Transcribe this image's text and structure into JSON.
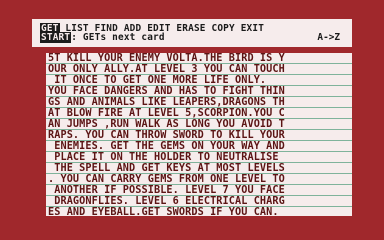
{
  "menu": {
    "get": "GET",
    "rest": " LIST FIND ADD EDIT ERASE COPY EXIT",
    "start": "START",
    "start_desc": ": GETs next card",
    "arrows": "A->Z"
  },
  "card": {
    "lines": [
      "5T KILL YOUR ENEMY VOLTA.THE BIRD IS Y",
      "OUR ONLY ALLY.AT LEVEL 3 YOU CAN TOUCH",
      " IT ONCE TO GET ONE MORE LIFE ONLY.",
      "YOU FACE DANGERS AND HAS TO FIGHT THIN",
      "GS AND ANIMALS LIKE LEAPERS,DRAGONS TH",
      "AT BLOW FIRE AT LEVEL 5,SCORPION.YOU C",
      "AN JUMPS ,RUN WALK AS LONG YOU AVOID T",
      "RAPS. YOU CAN THROW SWORD TO KILL YOUR",
      " ENEMIES. GET THE GEMS ON YOUR WAY AND",
      " PLACE IT ON THE HOLDER TO NEUTRALISE",
      " THE SPELL AND GET KEYS AT MOST LEVELS",
      ". YOU CAN CARRY GEMS FROM ONE LEVEL TO",
      " ANOTHER IF POSSIBLE. LEVEL 7 YOU FACE",
      " DRAGONFLIES. LEVEL 6 ELECTRICAL CHARG",
      "ES AND EYEBALL.GET SWORDS IF YOU CAN.",
      ""
    ]
  }
}
